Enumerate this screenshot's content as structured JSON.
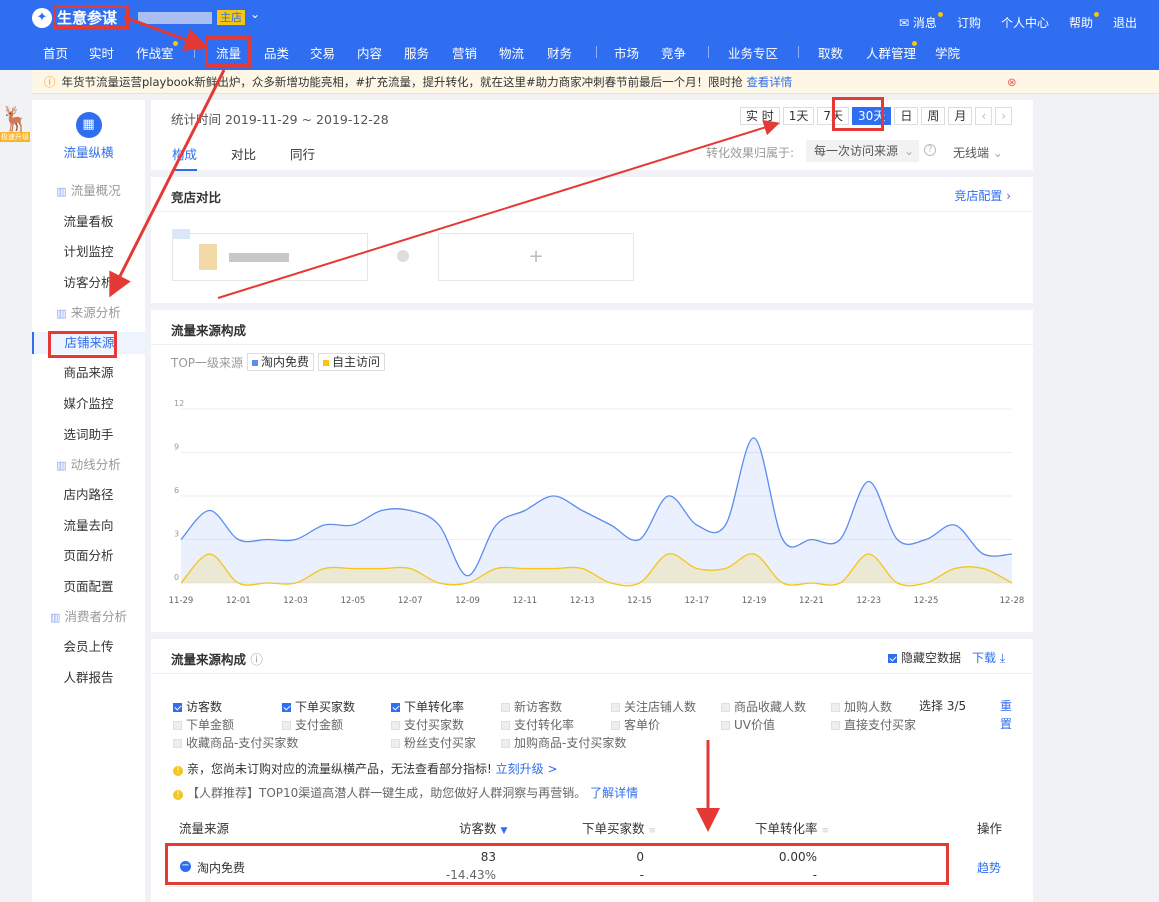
{
  "header": {
    "brand": "生意参谋",
    "shop_badge": "主店",
    "right_links": [
      "消息",
      "订购",
      "个人中心",
      "帮助",
      "退出"
    ],
    "nav": [
      "首页",
      "实时",
      "作战室",
      "流量",
      "品类",
      "交易",
      "内容",
      "服务",
      "营销",
      "物流",
      "财务",
      "市场",
      "竞争",
      "业务专区",
      "取数",
      "人群管理",
      "学院"
    ],
    "active_nav": "流量"
  },
  "notice": {
    "text": "年货节流量运营playbook新鲜出炉，众多新增功能亮相，#扩充流量，提升转化，就在这里#助力商家冲刺春节前最后一个月！限时抢",
    "link": "查看详情"
  },
  "mascot": {
    "badge": "极速升级"
  },
  "sidebar": {
    "title": "流量纵横",
    "groups": [
      {
        "label": "流量概况",
        "items": [
          "流量看板",
          "计划监控",
          "访客分析"
        ]
      },
      {
        "label": "来源分析",
        "items": [
          "店铺来源",
          "商品来源",
          "媒介监控",
          "选词助手"
        ]
      },
      {
        "label": "动线分析",
        "items": [
          "店内路径",
          "流量去向",
          "页面分析",
          "页面配置"
        ]
      },
      {
        "label": "消费者分析",
        "items": [
          "会员上传",
          "人群报告"
        ]
      }
    ],
    "active": "店铺来源"
  },
  "timebar": {
    "stat_label": "统计时间 2019-11-29 ~ 2019-12-28",
    "buttons": [
      "实 时",
      "1天",
      "7天",
      "30天",
      "日",
      "周",
      "月"
    ],
    "active": "30天",
    "tabs": [
      "构成",
      "对比",
      "同行"
    ],
    "active_tab": "构成",
    "attribution_label": "转化效果归属于:",
    "attribution_value": "每一次访问来源",
    "device": "无线端"
  },
  "compare": {
    "title": "竞店对比",
    "config_link": "竞店配置",
    "add_symbol": "+"
  },
  "chart_card": {
    "title": "流量来源构成",
    "legend_prefix": "TOP一级来源"
  },
  "chart_data": {
    "type": "area",
    "x": [
      "11-29",
      "11-30",
      "12-01",
      "12-02",
      "12-03",
      "12-04",
      "12-05",
      "12-06",
      "12-07",
      "12-08",
      "12-09",
      "12-10",
      "12-11",
      "12-12",
      "12-13",
      "12-14",
      "12-15",
      "12-16",
      "12-17",
      "12-18",
      "12-19",
      "12-20",
      "12-21",
      "12-22",
      "12-23",
      "12-24",
      "12-25",
      "12-26",
      "12-27",
      "12-28"
    ],
    "x_tick_labels": [
      "11-29",
      "12-01",
      "12-03",
      "12-05",
      "12-07",
      "12-09",
      "12-11",
      "12-13",
      "12-15",
      "12-17",
      "12-19",
      "12-21",
      "12-23",
      "12-25",
      "12-28"
    ],
    "ylim": [
      0,
      12
    ],
    "y_ticks": [
      0,
      3,
      6,
      9,
      12
    ],
    "series": [
      {
        "name": "淘内免费",
        "color": "#5b8def",
        "values": [
          3,
          5,
          3,
          3,
          3,
          4,
          4,
          5,
          5,
          4,
          0.5,
          4,
          5,
          6,
          5,
          4,
          3,
          6,
          4,
          4,
          10,
          3,
          3,
          3,
          7,
          3,
          3,
          4,
          2,
          2
        ]
      },
      {
        "name": "自主访问",
        "color": "#f5c518",
        "values": [
          0,
          2,
          0,
          0,
          0,
          1,
          1,
          1,
          1,
          0,
          0,
          1,
          1,
          1,
          1,
          0,
          0,
          2,
          1,
          1,
          2,
          0,
          0,
          0,
          2,
          0,
          0,
          1,
          1,
          0
        ]
      }
    ],
    "grid": true,
    "legend_position": "top-left"
  },
  "table_card": {
    "title": "流量来源构成",
    "hide_empty": "隐藏空数据",
    "download": "下载",
    "metrics": [
      {
        "label": "访客数",
        "on": true
      },
      {
        "label": "下单买家数",
        "on": true
      },
      {
        "label": "下单转化率",
        "on": true
      },
      {
        "label": "新访客数",
        "on": false
      },
      {
        "label": "关注店铺人数",
        "on": false
      },
      {
        "label": "商品收藏人数",
        "on": false
      },
      {
        "label": "加购人数",
        "on": false
      },
      {
        "label": "下单金额",
        "on": false
      },
      {
        "label": "支付金额",
        "on": false
      },
      {
        "label": "支付买家数",
        "on": false
      },
      {
        "label": "支付转化率",
        "on": false
      },
      {
        "label": "客单价",
        "on": false
      },
      {
        "label": "UV价值",
        "on": false
      },
      {
        "label": "直接支付买家",
        "on": false
      },
      {
        "label": "收藏商品-支付买家数",
        "on": false
      },
      {
        "label": "粉丝支付买家",
        "on": false
      },
      {
        "label": "加购商品-支付买家数",
        "on": false
      }
    ],
    "choose": "选择 3/5",
    "reset": "重置",
    "tip1": "亲，您尚未订购对应的流量纵横产品，无法查看部分指标!",
    "tip1_link": "立刻升级 >",
    "tip2": "【人群推荐】TOP10渠道高潜人群一键生成，助您做好人群洞察与再营销。",
    "tip2_link": "了解详情",
    "columns": [
      "流量来源",
      "访客数",
      "下单买家数",
      "下单转化率",
      "操作"
    ],
    "row": {
      "source": "淘内免费",
      "visitors": "83",
      "visitors_change": "-14.43%",
      "buyers": "0",
      "buyers_change": "-",
      "rate": "0.00%",
      "rate_change": "-",
      "action": "趋势"
    }
  }
}
